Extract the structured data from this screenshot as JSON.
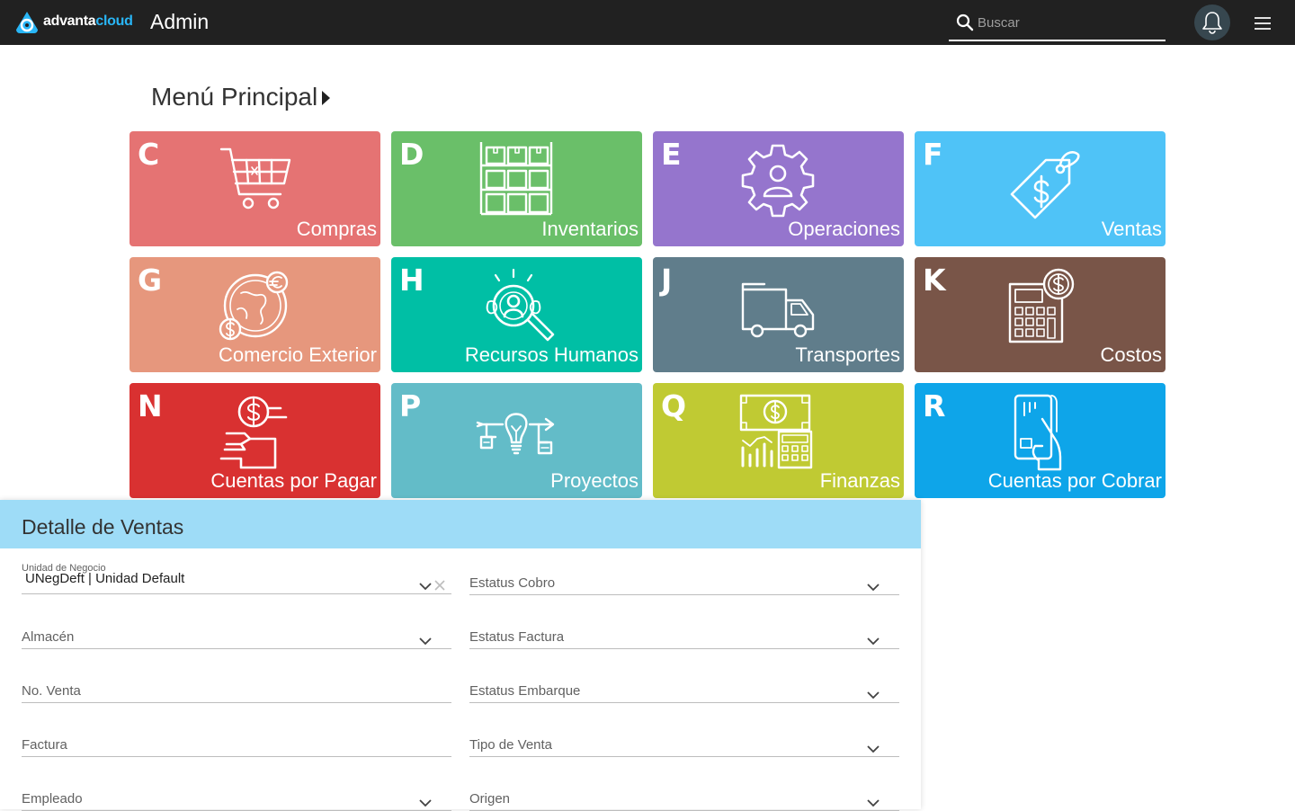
{
  "topbar": {
    "brand_part1": "advanta",
    "brand_part2": "cloud",
    "app_title": "Admin",
    "search_placeholder": "Buscar",
    "colors": {
      "background": "#212121",
      "brand_accent": "#29b6f6"
    }
  },
  "menu": {
    "title": "Menú Principal",
    "tiles": [
      {
        "letter": "C",
        "label": "Compras",
        "color": "#e57373",
        "icon": "shopping-cart-icon"
      },
      {
        "letter": "D",
        "label": "Inventarios",
        "color": "#6abf69",
        "icon": "warehouse-boxes-icon"
      },
      {
        "letter": "E",
        "label": "Operaciones",
        "color": "#9575cd",
        "icon": "gear-person-icon"
      },
      {
        "letter": "F",
        "label": "Ventas",
        "color": "#4fc3f7",
        "icon": "price-tag-icon"
      },
      {
        "letter": "G",
        "label": "Comercio Exterior",
        "color": "#e6977d",
        "icon": "globe-currency-icon"
      },
      {
        "letter": "H",
        "label": "Recursos Humanos",
        "color": "#00bfa5",
        "icon": "magnifier-person-icon"
      },
      {
        "letter": "J",
        "label": "Transportes",
        "color": "#607d8b",
        "icon": "truck-icon"
      },
      {
        "letter": "K",
        "label": "Costos",
        "color": "#795548",
        "icon": "calculator-coin-icon"
      },
      {
        "letter": "N",
        "label": "Cuentas por Pagar",
        "color": "#d93131",
        "icon": "hand-money-icon"
      },
      {
        "letter": "P",
        "label": "Proyectos",
        "color": "#63bcc8",
        "icon": "lightbulb-project-icon"
      },
      {
        "letter": "Q",
        "label": "Finanzas",
        "color": "#c0ca33",
        "icon": "finance-chart-icon"
      },
      {
        "letter": "R",
        "label": "Cuentas por Cobrar",
        "color": "#0ea5e9",
        "icon": "card-hand-icon"
      }
    ]
  },
  "detail": {
    "title": "Detalle de Ventas",
    "header_color": "#9edcf7",
    "left_fields": [
      {
        "label": "Unidad de Negocio",
        "value": "UNegDeft | Unidad Default",
        "type": "select"
      },
      {
        "label": "Almacén",
        "value": "",
        "type": "select"
      },
      {
        "label": "No. Venta",
        "value": "",
        "type": "text"
      },
      {
        "label": "Factura",
        "value": "",
        "type": "text"
      },
      {
        "label": "Empleado",
        "value": "",
        "type": "select"
      }
    ],
    "right_fields": [
      {
        "label": "Estatus Cobro",
        "type": "select"
      },
      {
        "label": "Estatus Factura",
        "type": "select"
      },
      {
        "label": "Estatus Embarque",
        "type": "select"
      },
      {
        "label": "Tipo de Venta",
        "type": "select"
      },
      {
        "label": "Origen",
        "type": "select"
      }
    ]
  }
}
